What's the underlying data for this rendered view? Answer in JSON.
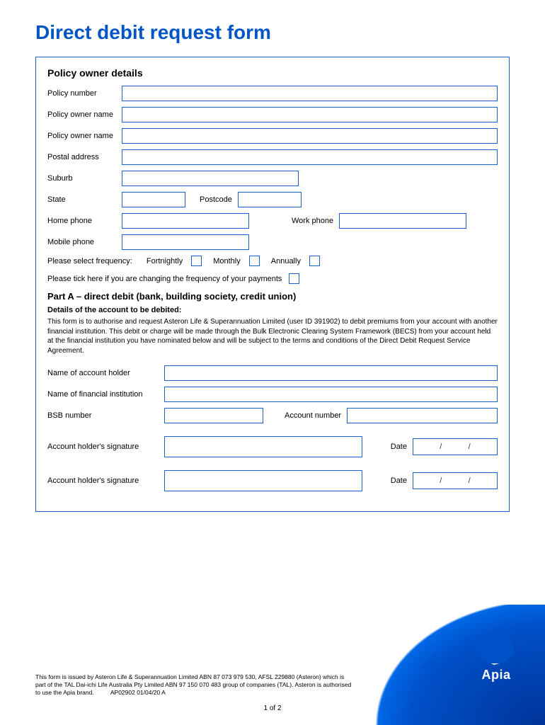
{
  "title": "Direct debit request form",
  "section_policy": "Policy owner details",
  "fields": {
    "policy_number": "Policy number",
    "policy_owner_name_1": "Policy owner name",
    "policy_owner_name_2": "Policy owner name",
    "postal_address": "Postal address",
    "suburb": "Suburb",
    "state": "State",
    "postcode": "Postcode",
    "home_phone": "Home phone",
    "work_phone": "Work phone",
    "mobile_phone": "Mobile phone"
  },
  "frequency": {
    "prompt": "Please select frequency:",
    "fortnightly": "Fortnightly",
    "monthly": "Monthly",
    "annually": "Annually"
  },
  "tick_prompt": "Please tick here if you are changing the frequency of your payments",
  "part_a_title": "Part A – direct debit (bank, building society, credit union)",
  "details_heading": "Details of the account to be debited:",
  "details_paragraph": "This form is to authorise and request Asteron Life & Superannuation Limited (user ID 391902) to debit premiums from your account with another financial institution. This debit or charge will be made through the Bulk Electronic Clearing System Framework (BECS) from your account held at the financial institution you have nominated below and will be subject to the terms and conditions of the Direct Debit Request Service Agreement.",
  "account": {
    "holder_name": "Name of account holder",
    "institution": "Name of financial institution",
    "bsb": "BSB number",
    "account_number": "Account number",
    "signature": "Account holder's signature",
    "date": "Date"
  },
  "date_sep": "/",
  "footer_text": "This form is issued by Asteron Life & Superannuation Limited ABN 87 073 979 530, AFSL 229880 (Asteron) which is part of the TAL Dai-ichi Life Australia Pty Limited ABN 97 150 070 483 group of companies (TAL). Asteron is authorised to use the Apia brand.",
  "footer_code": "AP02902 01/04/20 A",
  "page_number": "1 of 2",
  "logo_text": "Apia"
}
